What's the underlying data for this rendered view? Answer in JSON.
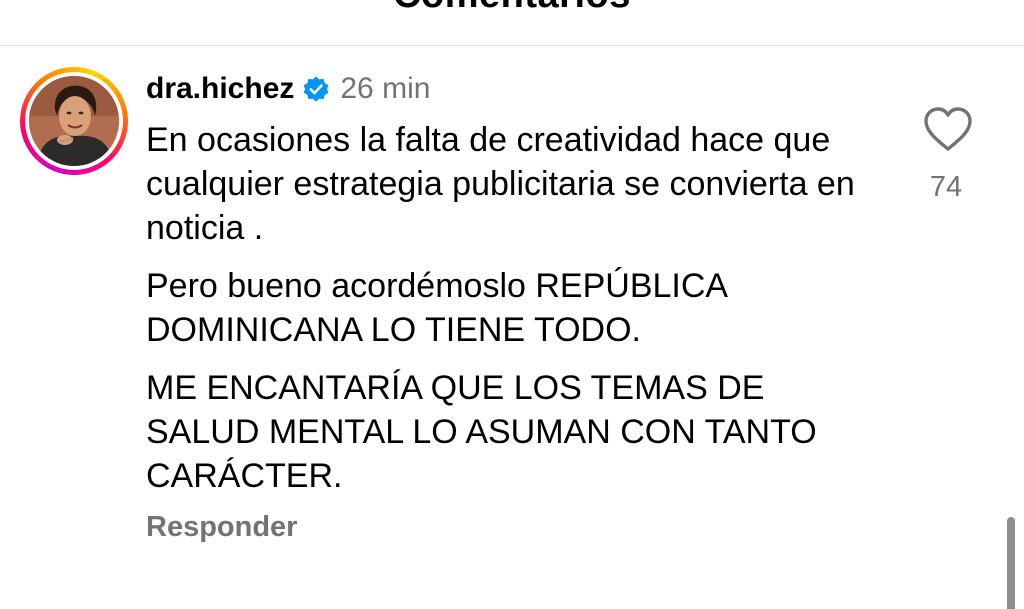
{
  "header": {
    "title": "Comentarios"
  },
  "comment": {
    "username": "dra.hichez",
    "time": "26 min",
    "paragraphs": [
      "En ocasiones la falta de creatividad hace que cualquier estrategia publicitaria se convierta en noticia .",
      "Pero bueno acordémoslo REPÚBLICA DOMINICANA LO TIENE TODO.",
      "ME ENCANTARÍA QUE LOS TEMAS DE SALUD MENTAL LO ASUMAN CON TANTO CARÁCTER."
    ],
    "reply_label": "Responder",
    "like_count": "74"
  },
  "icons": {
    "verified": "verified-badge-icon",
    "like": "heart-icon"
  },
  "colors": {
    "verified_blue": "#0095f6",
    "secondary_text": "#737373"
  }
}
